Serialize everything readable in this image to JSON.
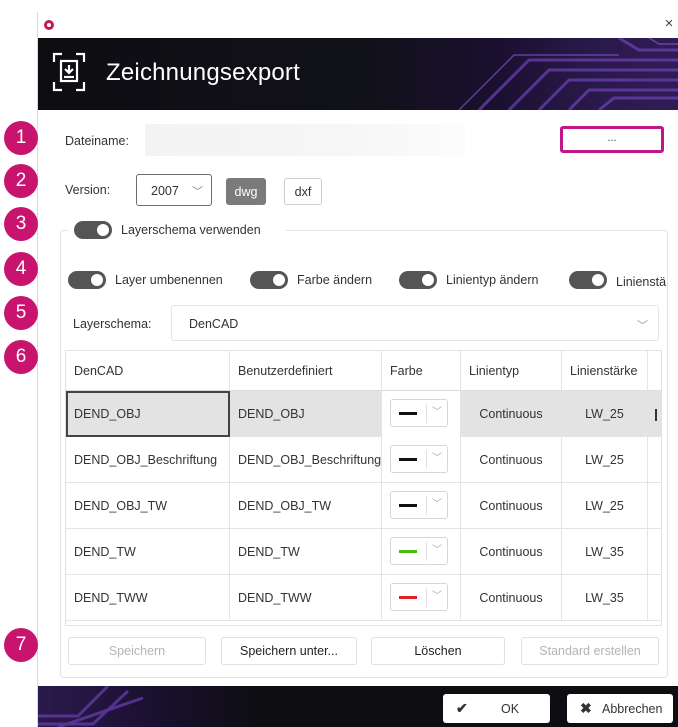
{
  "window": {
    "title": "Zeichnungsexport",
    "close_glyph": "×"
  },
  "form": {
    "filename_label": "Dateiname:",
    "filename_value": "",
    "browse_label": "...",
    "version_label": "Version:",
    "version_value": "2007",
    "format_dwg": "dwg",
    "format_dxf": "dxf",
    "selected_format": "dwg"
  },
  "layerschema_toggle": {
    "label": "Layerschema verwenden",
    "on": true
  },
  "options": [
    {
      "label": "Layer umbenennen",
      "on": true
    },
    {
      "label": "Farbe ändern",
      "on": true
    },
    {
      "label": "Linientyp ändern",
      "on": true
    },
    {
      "label": "Linienstä",
      "on": true
    }
  ],
  "schema": {
    "label": "Layerschema:",
    "value": "DenCAD"
  },
  "table": {
    "columns": [
      "DenCAD",
      "Benutzerdefiniert",
      "Farbe",
      "Linientyp",
      "Linienstärke"
    ],
    "rows": [
      {
        "dencad": "DEND_OBJ",
        "custom": "DEND_OBJ",
        "color": "#111111",
        "linetype": "Continuous",
        "lineweight": "LW_25",
        "selected": true
      },
      {
        "dencad": "DEND_OBJ_Beschriftung",
        "custom": "DEND_OBJ_Beschriftung",
        "color": "#111111",
        "linetype": "Continuous",
        "lineweight": "LW_25",
        "selected": false
      },
      {
        "dencad": "DEND_OBJ_TW",
        "custom": "DEND_OBJ_TW",
        "color": "#111111",
        "linetype": "Continuous",
        "lineweight": "LW_25",
        "selected": false
      },
      {
        "dencad": "DEND_TW",
        "custom": "DEND_TW",
        "color": "#4cbb17",
        "linetype": "Continuous",
        "lineweight": "LW_35",
        "selected": false
      },
      {
        "dencad": "DEND_TWW",
        "custom": "DEND_TWW",
        "color": "#e0202a",
        "linetype": "Continuous",
        "lineweight": "LW_35",
        "selected": false
      }
    ]
  },
  "actions": {
    "save": "Speichern",
    "save_as": "Speichern unter...",
    "delete": "Löschen",
    "create_default": "Standard erstellen"
  },
  "footer": {
    "ok": "OK",
    "cancel": "Abbrechen"
  },
  "callouts": [
    "1",
    "2",
    "3",
    "4",
    "5",
    "6",
    "7"
  ],
  "colors": {
    "accent": "#c0168a",
    "callout": "#c8146e",
    "header_dark": "#0d0d12",
    "toggle": "#555555"
  }
}
